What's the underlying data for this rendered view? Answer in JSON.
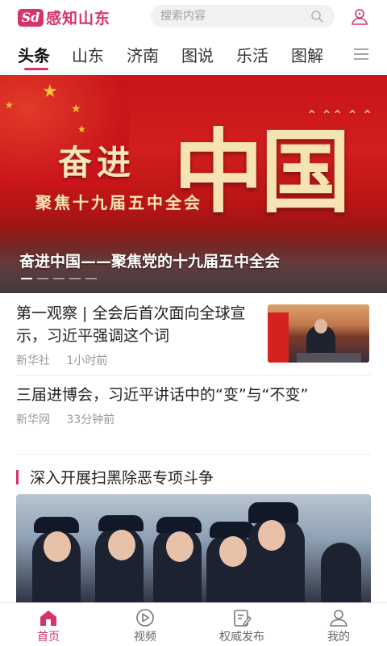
{
  "header": {
    "logo_mark": "Sd",
    "logo_text": "感知山东",
    "search_placeholder": "搜索内容"
  },
  "tabs": [
    "头条",
    "山东",
    "济南",
    "图说",
    "乐活",
    "图解"
  ],
  "banner": {
    "headline": "奋进",
    "big_text": "中国",
    "subtitle": "聚焦十九届五中全会",
    "caption": "奋进中国——聚焦党的十九届五中全会"
  },
  "news": [
    {
      "title": "第一观察 | 全会后首次面向全球宣示，习近平强调这个词",
      "source": "新华社",
      "time": "1小时前",
      "has_thumbnail": true
    },
    {
      "title": "三届进博会，习近平讲话中的“变”与“不变”",
      "source": "新华网",
      "time": "33分钟前",
      "has_thumbnail": false
    }
  ],
  "section": {
    "title": "深入开展扫黑除恶专项斗争"
  },
  "bottom_nav": [
    {
      "label": "首页",
      "icon": "home-icon",
      "active": true
    },
    {
      "label": "视频",
      "icon": "play-icon",
      "active": false
    },
    {
      "label": "权威发布",
      "icon": "edit-icon",
      "active": false
    },
    {
      "label": "我的",
      "icon": "user-icon",
      "active": false
    }
  ],
  "colors": {
    "accent": "#d6336c",
    "banner_red": "#c8141a"
  }
}
